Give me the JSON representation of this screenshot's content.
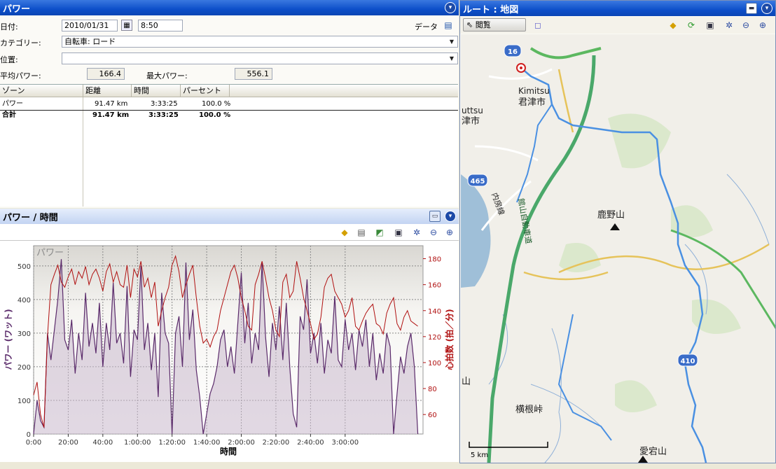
{
  "power_panel": {
    "title": "パワー",
    "date_label": "日付:",
    "date_value": "2010/01/31",
    "time_value": "8:50",
    "data_label": "データ",
    "category_label": "カテゴリー:",
    "category_value": "自転車: ロード",
    "location_label": "位置:",
    "location_value": "",
    "avg_power_label": "平均パワー:",
    "avg_power_value": "166.4",
    "max_power_label": "最大パワー:",
    "max_power_value": "556.1"
  },
  "zone_table": {
    "headers": [
      "ゾーン",
      "距離",
      "時間",
      "パーセント"
    ],
    "rows": [
      [
        "パワー",
        "91.47 km",
        "3:33:25",
        "100.0 %"
      ],
      [
        "合計",
        "91.47 km",
        "3:33:25",
        "100.0 %"
      ]
    ]
  },
  "chart_panel": {
    "title": "パワー / 時間",
    "watermark": "パワー"
  },
  "chart_data": {
    "type": "line",
    "xlabel": "時間",
    "ylabel": "パワー (ワット)",
    "y2label": "心拍数 (拍／分)",
    "xlim": [
      0,
      225
    ],
    "ylim": [
      0,
      560
    ],
    "y2lim": [
      45,
      190
    ],
    "x_ticks": [
      "0:00",
      "20:00",
      "40:00",
      "1:00:00",
      "1:20:00",
      "1:40:00",
      "2:00:00",
      "2:20:00",
      "2:40:00",
      "3:00:00"
    ],
    "y_ticks": [
      0,
      100,
      200,
      300,
      400,
      500
    ],
    "y2_ticks": [
      60,
      80,
      100,
      120,
      140,
      160,
      180
    ],
    "grid": true,
    "series": [
      {
        "color": "#5a2a6a",
        "x": [
          0,
          2,
          4,
          6,
          8,
          10,
          12,
          14,
          16,
          18,
          20,
          22,
          24,
          26,
          28,
          30,
          32,
          34,
          36,
          38,
          40,
          42,
          44,
          46,
          48,
          50,
          52,
          54,
          56,
          58,
          60,
          62,
          64,
          66,
          68,
          70,
          72,
          74,
          76,
          78,
          80,
          82,
          84,
          86,
          88,
          90,
          92,
          94,
          96,
          98,
          100,
          102,
          104,
          106,
          108,
          110,
          112,
          114,
          116,
          118,
          120,
          122,
          124,
          126,
          128,
          130,
          132,
          134,
          136,
          138,
          140,
          142,
          144,
          146,
          148,
          150,
          152,
          154,
          156,
          158,
          160,
          162,
          164,
          166,
          168,
          170,
          172,
          174,
          176,
          178,
          180,
          182,
          184,
          186,
          188,
          190,
          192,
          194,
          196,
          198,
          200,
          202,
          204,
          206,
          208,
          210,
          212,
          214,
          216,
          218,
          220,
          222
        ],
        "y": [
          0,
          100,
          40,
          20,
          300,
          220,
          310,
          400,
          520,
          280,
          250,
          340,
          180,
          300,
          220,
          420,
          260,
          330,
          240,
          390,
          200,
          330,
          250,
          450,
          270,
          300,
          210,
          440,
          170,
          310,
          280,
          500,
          250,
          330,
          190,
          300,
          110,
          420,
          300,
          270,
          0,
          300,
          350,
          200,
          510,
          280,
          370,
          190,
          110,
          0,
          60,
          120,
          150,
          200,
          280,
          310,
          200,
          260,
          180,
          330,
          480,
          270,
          390,
          210,
          300,
          250,
          510,
          290,
          170,
          330,
          250,
          380,
          220,
          390,
          200,
          60,
          20,
          350,
          310,
          460,
          240,
          300,
          210,
          330,
          180,
          280,
          240,
          410,
          220,
          200,
          340,
          250,
          300,
          190,
          310,
          260,
          340,
          200,
          300,
          160,
          240,
          180,
          300,
          260,
          0,
          120,
          230,
          180,
          260,
          300,
          200,
          0
        ]
      },
      {
        "color": "#b01010",
        "x": [
          0,
          2,
          4,
          6,
          8,
          10,
          12,
          14,
          16,
          18,
          20,
          22,
          24,
          26,
          28,
          30,
          32,
          34,
          36,
          38,
          40,
          42,
          44,
          46,
          48,
          50,
          52,
          54,
          56,
          58,
          60,
          62,
          64,
          66,
          68,
          70,
          72,
          74,
          76,
          78,
          80,
          82,
          84,
          86,
          88,
          90,
          92,
          94,
          96,
          98,
          100,
          102,
          104,
          106,
          108,
          110,
          112,
          114,
          116,
          118,
          120,
          122,
          124,
          126,
          128,
          130,
          132,
          134,
          136,
          138,
          140,
          142,
          144,
          146,
          148,
          150,
          152,
          154,
          156,
          158,
          160,
          162,
          164,
          166,
          168,
          170,
          172,
          174,
          176,
          178,
          180,
          182,
          184,
          186,
          188,
          190,
          192,
          194,
          196,
          198,
          200,
          202,
          204,
          206,
          208,
          210,
          212,
          214,
          216,
          218,
          220,
          222
        ],
        "y": [
          75,
          85,
          60,
          50,
          120,
          160,
          168,
          175,
          162,
          158,
          166,
          172,
          160,
          170,
          165,
          174,
          160,
          168,
          172,
          165,
          155,
          170,
          176,
          162,
          170,
          160,
          158,
          175,
          150,
          172,
          166,
          178,
          158,
          165,
          150,
          162,
          128,
          140,
          150,
          158,
          175,
          182,
          170,
          150,
          160,
          168,
          175,
          150,
          128,
          115,
          118,
          112,
          120,
          125,
          140,
          150,
          160,
          170,
          175,
          165,
          150,
          140,
          128,
          125,
          160,
          168,
          178,
          165,
          150,
          140,
          125,
          120,
          162,
          168,
          150,
          155,
          178,
          165,
          150,
          140,
          130,
          118,
          122,
          135,
          158,
          165,
          168,
          155,
          150,
          145,
          135,
          140,
          150,
          128,
          125,
          132,
          138,
          142,
          145,
          130,
          128,
          122,
          138,
          145,
          150,
          130,
          125,
          135,
          140,
          132,
          130,
          128
        ]
      }
    ]
  },
  "map_panel": {
    "title": "ルート : 地図",
    "browse_label": "閲覧",
    "scale_label": "5 km",
    "labels": {
      "kimitsu_en": "Kimitsu",
      "kimitsu_jp": "君津市",
      "futtsu_en": "uttsu",
      "futtsu_jp": "津市",
      "kanozan": "鹿野山",
      "yokone": "横根峠",
      "atago": "愛宕山",
      "nakayama": "山",
      "uchibo": "内房線",
      "expressway": "館山自動車道",
      "r16": "16",
      "r465": "465",
      "r410": "410"
    }
  }
}
